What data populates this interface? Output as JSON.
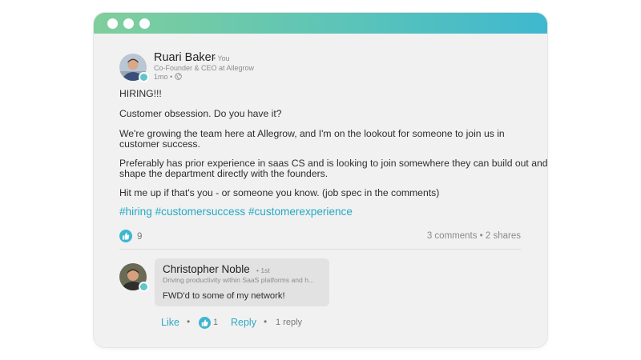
{
  "post": {
    "author": {
      "name": "Ruari Baker",
      "badge": "• You",
      "headline": "Co-Founder & CEO at Allegrow",
      "time": "1mo  •"
    },
    "body_lines": [
      "HIRING!!!",
      "Customer obsession. Do you have it?",
      "We're growing the team here at Allegrow, and I'm on the lookout for someone to join us in",
      "customer success.",
      "Preferably has prior experience in saas CS and is looking to join somewhere they can build out and",
      "shape the department directly with the founders.",
      "Hit me up if that's you - or someone you know. (job spec in the comments)"
    ],
    "hashtags": [
      "#hiring",
      "#customersuccess",
      "#customerexperience"
    ],
    "likes_count": "9",
    "stats": "3 comments  •  2 shares"
  },
  "comment": {
    "author": {
      "name": "Christopher Noble",
      "degree": "• 1st",
      "headline": "Driving productivity within SaaS platforms and h..."
    },
    "text": "FWD'd to some of my network!",
    "like_label": "Like",
    "likes_count": "1",
    "reply_label": "Reply",
    "replies": "1 reply"
  },
  "icons": {
    "window_controls": "three-dots",
    "reaction": "thumbs-up-icon",
    "visibility": "globe-icon"
  },
  "colors": {
    "accent": "#34a9c3",
    "titlebar_gradient": [
      "#7fcf9c",
      "#3fb8cf"
    ]
  }
}
